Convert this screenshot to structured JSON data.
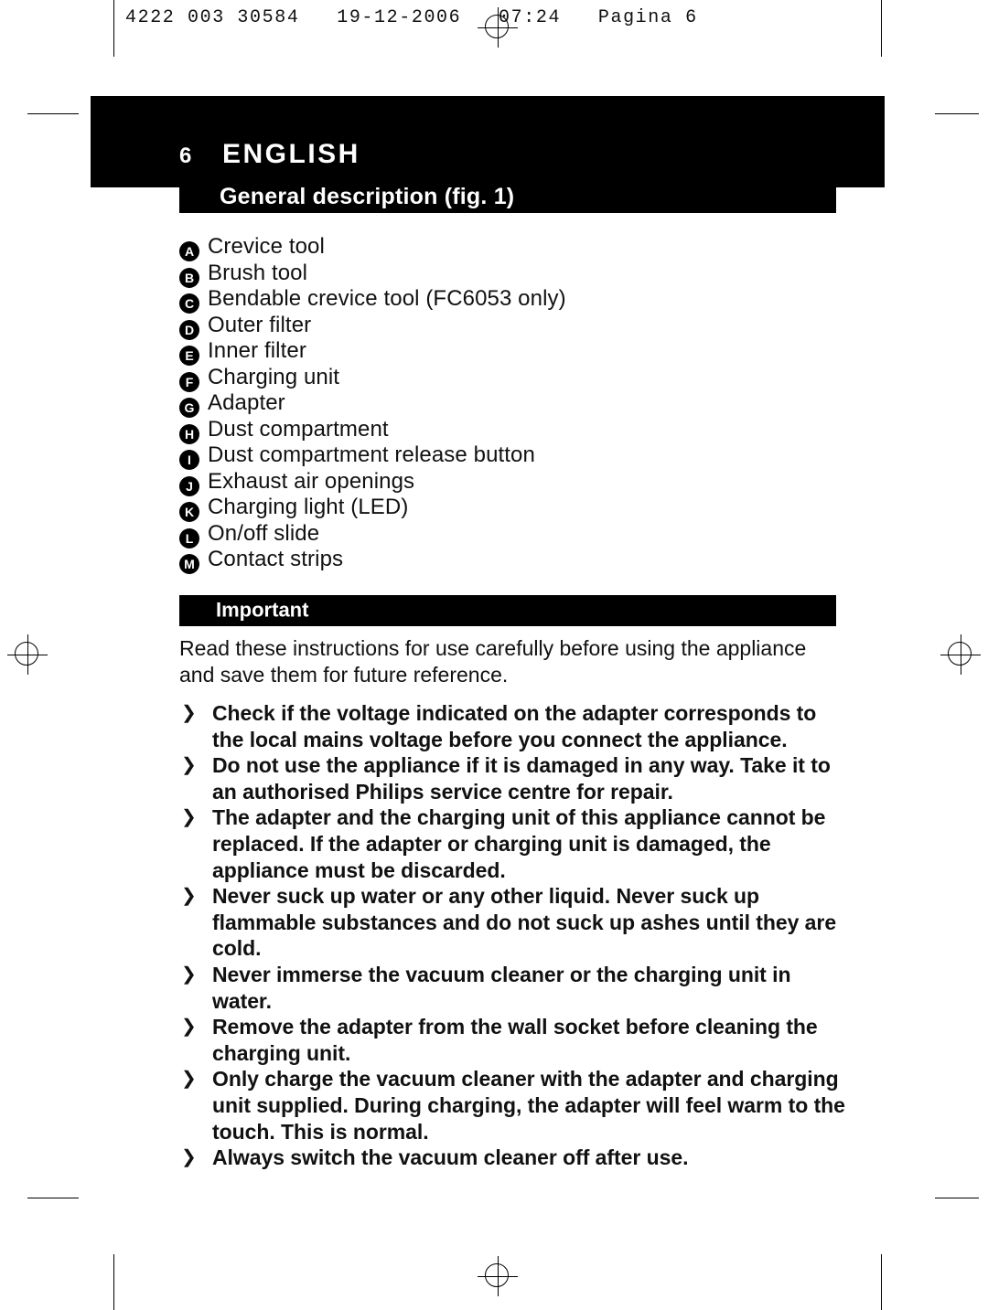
{
  "print_header": "4222 003 30584   19-12-2006   07:24   Pagina 6",
  "chapter": {
    "number": "6",
    "title": "ENGLISH"
  },
  "sections": {
    "general_description": "General description (fig. 1)",
    "important": "Important"
  },
  "parts": [
    {
      "letter": "A",
      "label": "Crevice tool"
    },
    {
      "letter": "B",
      "label": "Brush tool"
    },
    {
      "letter": "C",
      "label": "Bendable crevice tool (FC6053 only)"
    },
    {
      "letter": "D",
      "label": "Outer filter"
    },
    {
      "letter": "E",
      "label": "Inner filter"
    },
    {
      "letter": "F",
      "label": "Charging unit"
    },
    {
      "letter": "G",
      "label": "Adapter"
    },
    {
      "letter": "H",
      "label": "Dust compartment"
    },
    {
      "letter": "I",
      "label": "Dust compartment release button"
    },
    {
      "letter": "J",
      "label": "Exhaust air openings"
    },
    {
      "letter": "K",
      "label": "Charging light (LED)"
    },
    {
      "letter": "L",
      "label": "On/off slide"
    },
    {
      "letter": "M",
      "label": "Contact strips"
    }
  ],
  "important_intro": "Read these instructions for use carefully before using the appliance and save them for future reference.",
  "warnings": [
    "Check if the voltage indicated on the adapter corresponds to the local mains voltage before you connect the appliance.",
    "Do not use the appliance if it is damaged in any way. Take it to an authorised Philips service centre for repair.",
    "The adapter and the charging unit of this appliance cannot be replaced. If the adapter or charging unit is damaged, the appliance must be discarded.",
    "Never suck up water or any other liquid. Never suck up flammable substances and do not suck up ashes until they are cold.",
    "Never immerse the vacuum cleaner or the charging unit in water.",
    "Remove the adapter from the wall socket before cleaning the charging unit.",
    "Only charge the vacuum cleaner with the adapter and charging unit supplied. During charging, the adapter will feel warm to the touch. This is normal.",
    "Always switch the vacuum cleaner off after use."
  ],
  "bullet_glyph": "❯",
  "colors": {
    "banner": "#000000",
    "text": "#111111",
    "page": "#ffffff"
  }
}
